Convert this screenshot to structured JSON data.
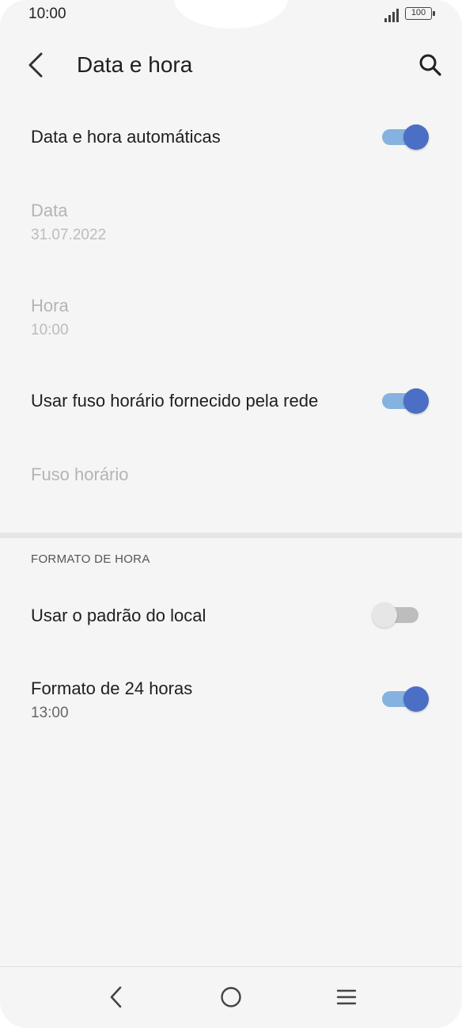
{
  "status_bar": {
    "time": "10:00",
    "battery": "100"
  },
  "toolbar": {
    "title": "Data e hora",
    "back_icon": "arrow-left-icon",
    "search_icon": "search-icon"
  },
  "settings": {
    "auto_datetime": {
      "label": "Data e hora automáticas",
      "enabled": true
    },
    "date": {
      "label": "Data",
      "value": "31.07.2022",
      "disabled": true
    },
    "time": {
      "label": "Hora",
      "value": "10:00",
      "disabled": true
    },
    "network_timezone": {
      "label": "Usar fuso horário fornecido pela rede",
      "enabled": true
    },
    "timezone": {
      "label": "Fuso horário",
      "disabled": true
    }
  },
  "time_format": {
    "header": "FORMATO DE HORA",
    "use_locale_default": {
      "label": "Usar o padrão do local",
      "enabled": false
    },
    "format_24h": {
      "label": "Formato de 24 horas",
      "value": "13:00",
      "enabled": true
    }
  },
  "colors": {
    "accent": "#4a6fc4",
    "accent_track": "#86b2e0",
    "background": "#f5f5f5",
    "text_primary": "#202020",
    "text_disabled": "#b4b4b4"
  },
  "nav_bar": {
    "back_icon": "nav-back-icon",
    "home_icon": "nav-home-icon",
    "menu_icon": "nav-menu-icon"
  }
}
